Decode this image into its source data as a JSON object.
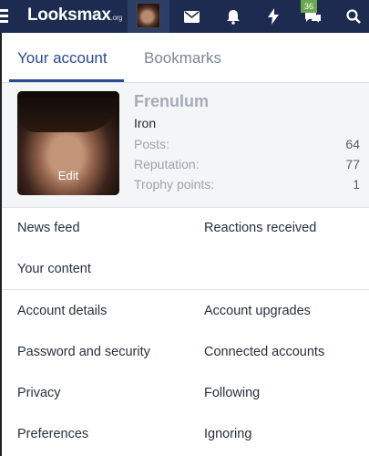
{
  "topbar": {
    "logo_main": "Looksmax",
    "logo_suffix": ".org",
    "badge_count": "36"
  },
  "tabs": [
    {
      "label": "Your account"
    },
    {
      "label": "Bookmarks"
    }
  ],
  "profile": {
    "username": "Frenulum",
    "rank": "Iron",
    "edit_label": "Edit",
    "stats": [
      {
        "label": "Posts:",
        "value": "64"
      },
      {
        "label": "Reputation:",
        "value": "77"
      },
      {
        "label": "Trophy points:",
        "value": "1"
      }
    ]
  },
  "links": {
    "news_feed": "News feed",
    "reactions_received": "Reactions received",
    "your_content": "Your content",
    "account_details": "Account details",
    "account_upgrades": "Account upgrades",
    "password_security": "Password and security",
    "connected_accounts": "Connected accounts",
    "privacy": "Privacy",
    "following": "Following",
    "preferences": "Preferences",
    "ignoring": "Ignoring"
  }
}
